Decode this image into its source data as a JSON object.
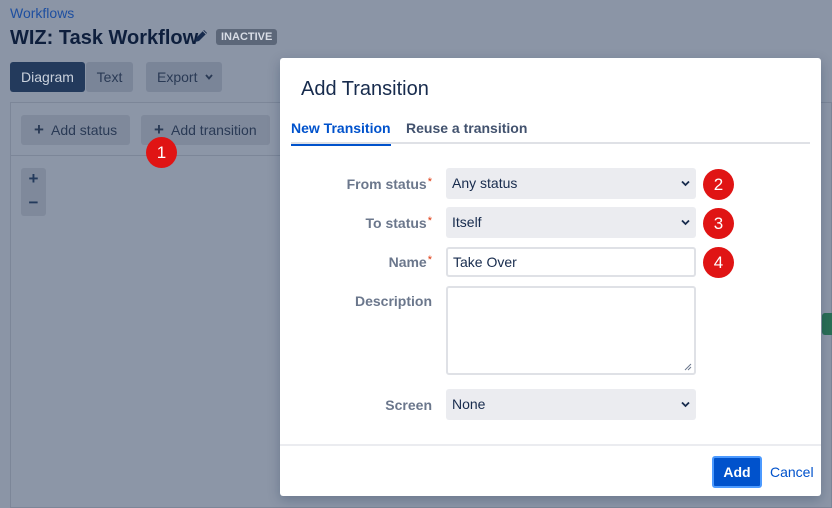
{
  "breadcrumb": "Workflows",
  "workflow": {
    "title": "WIZ: Task Workflow",
    "status": "INACTIVE"
  },
  "view_tabs": {
    "diagram": "Diagram",
    "text": "Text",
    "export": "Export"
  },
  "toolbar": {
    "add_status": "Add status",
    "add_transition": "Add transition"
  },
  "zoom": {
    "in": "+",
    "out": "−"
  },
  "markers": [
    "1",
    "2",
    "3",
    "4"
  ],
  "modal": {
    "title": "Add Transition",
    "tabs": {
      "new": "New Transition",
      "reuse": "Reuse a transition"
    },
    "fields": {
      "from_status": {
        "label": "From status",
        "value": "Any status"
      },
      "to_status": {
        "label": "To status",
        "value": "Itself"
      },
      "name": {
        "label": "Name",
        "value": "Take Over"
      },
      "description": {
        "label": "Description",
        "value": ""
      },
      "screen": {
        "label": "Screen",
        "value": "None"
      }
    },
    "required_mark": "*",
    "buttons": {
      "add": "Add",
      "cancel": "Cancel"
    }
  },
  "colors": {
    "primary": "#0052cc",
    "marker": "#e01414",
    "required": "#de350b",
    "overlay": "#8993a4"
  },
  "icons": {
    "edit": "pencil-icon",
    "dropdown": "chevron-down-icon",
    "add": "plus-icon"
  }
}
